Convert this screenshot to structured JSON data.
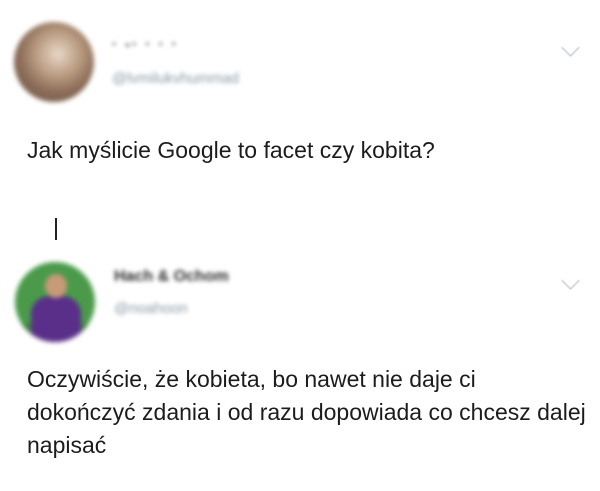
{
  "tweets": [
    {
      "author_name": "· -·  ·  · ·",
      "author_handle": "@lvmilukvhummad",
      "text": "Jak myślicie Google to facet czy kobita?"
    },
    {
      "author_name": "Hach & Ochom",
      "author_handle": "@noahoon",
      "text": "Oczywiście, że kobieta, bo nawet nie daje ci dokończyć zdania i od razu dopowiada co chcesz dalej napisać"
    }
  ],
  "icons": {
    "more_options": "chevron-down-icon"
  },
  "colors": {
    "background": "#ffffff",
    "text": "#1c1c1c",
    "handle": "#8899a6",
    "chevron": "#aab8c2",
    "thread_line": "#222222"
  }
}
